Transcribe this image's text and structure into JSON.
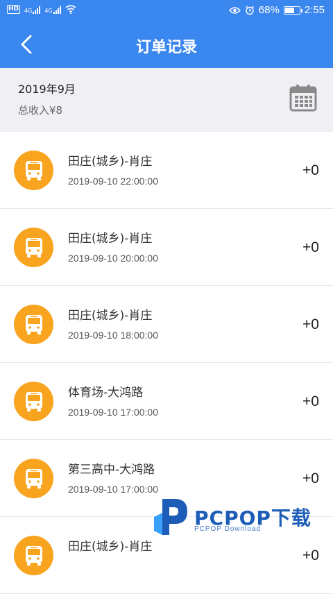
{
  "status_bar": {
    "hd_label": "HD",
    "signal1_label": "4G",
    "signal2_label": "4G",
    "battery_percent": "68%",
    "battery_level": 0.68,
    "time": "2:55"
  },
  "header": {
    "title": "订单记录",
    "back_icon": "chevron-left-icon"
  },
  "summary": {
    "month": "2019年9月",
    "total_income": "总收入¥8",
    "calendar_icon": "calendar-icon"
  },
  "orders": [
    {
      "route": "田庄(城乡)-肖庄",
      "time": "2019-09-10 22:00:00",
      "amount": "+0"
    },
    {
      "route": "田庄(城乡)-肖庄",
      "time": "2019-09-10 20:00:00",
      "amount": "+0"
    },
    {
      "route": "田庄(城乡)-肖庄",
      "time": "2019-09-10 18:00:00",
      "amount": "+0"
    },
    {
      "route": "体育场-大鸿路",
      "time": "2019-09-10 17:00:00",
      "amount": "+0"
    },
    {
      "route": "第三高中-大鸿路",
      "time": "2019-09-10 17:00:00",
      "amount": "+0"
    },
    {
      "route": "田庄(城乡)-肖庄",
      "time": "",
      "amount": "+0"
    }
  ],
  "colors": {
    "primary": "#3b87f0",
    "bus_icon_bg": "#f8a41e",
    "summary_bg": "#efeff4"
  },
  "watermark": {
    "brand": "PCPOP下载",
    "sub": "PCPOP Download"
  }
}
